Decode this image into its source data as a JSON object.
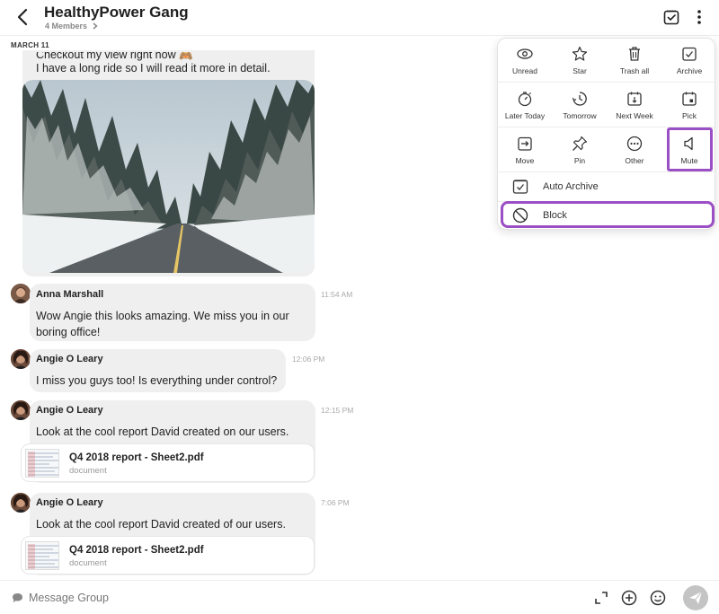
{
  "header": {
    "title": "HealthyPower Gang",
    "members": "4 Members"
  },
  "date_label": "MARCH 11",
  "first_message": {
    "partial_line": "Checkout my view right now 🙈",
    "line2": "I have a long ride so I will read it more in detail."
  },
  "messages": [
    {
      "sender": "Anna Marshall",
      "time": "11:54 AM",
      "text": "Wow Angie this looks amazing. We miss you in our boring office!"
    },
    {
      "sender": "Angie O Leary",
      "time": "12:06 PM",
      "text": "I miss you guys too! Is everything under control?"
    },
    {
      "sender": "Angie O Leary",
      "time": "12:15 PM",
      "text": "Look at the cool report David created on our users.",
      "attachment": {
        "name": "Q4 2018 report - Sheet2.pdf",
        "type": "document"
      }
    },
    {
      "sender": "Angie O Leary",
      "time": "7:06 PM",
      "text": "Look at the cool report David created of our users.",
      "attachment": {
        "name": "Q4 2018 report - Sheet2.pdf",
        "type": "document"
      }
    }
  ],
  "composer": {
    "placeholder": "Message Group"
  },
  "menu": {
    "row1": [
      {
        "label": "Unread",
        "icon": "eye-icon"
      },
      {
        "label": "Star",
        "icon": "star-icon"
      },
      {
        "label": "Trash all",
        "icon": "trash-icon"
      },
      {
        "label": "Archive",
        "icon": "archive-check-icon"
      }
    ],
    "row2": [
      {
        "label": "Later Today",
        "icon": "stopwatch-icon"
      },
      {
        "label": "Tomorrow",
        "icon": "clock-icon"
      },
      {
        "label": "Next Week",
        "icon": "calendar-down-icon"
      },
      {
        "label": "Pick",
        "icon": "calendar-pick-icon"
      }
    ],
    "row3": [
      {
        "label": "Move",
        "icon": "move-icon"
      },
      {
        "label": "Pin",
        "icon": "pin-icon"
      },
      {
        "label": "Other",
        "icon": "ellipsis-circle-icon"
      },
      {
        "label": "Mute",
        "icon": "speaker-icon"
      }
    ],
    "auto_archive": "Auto Archive",
    "block": "Block"
  },
  "colors": {
    "highlight": "#9b4fc4",
    "bubble": "#efefef"
  }
}
